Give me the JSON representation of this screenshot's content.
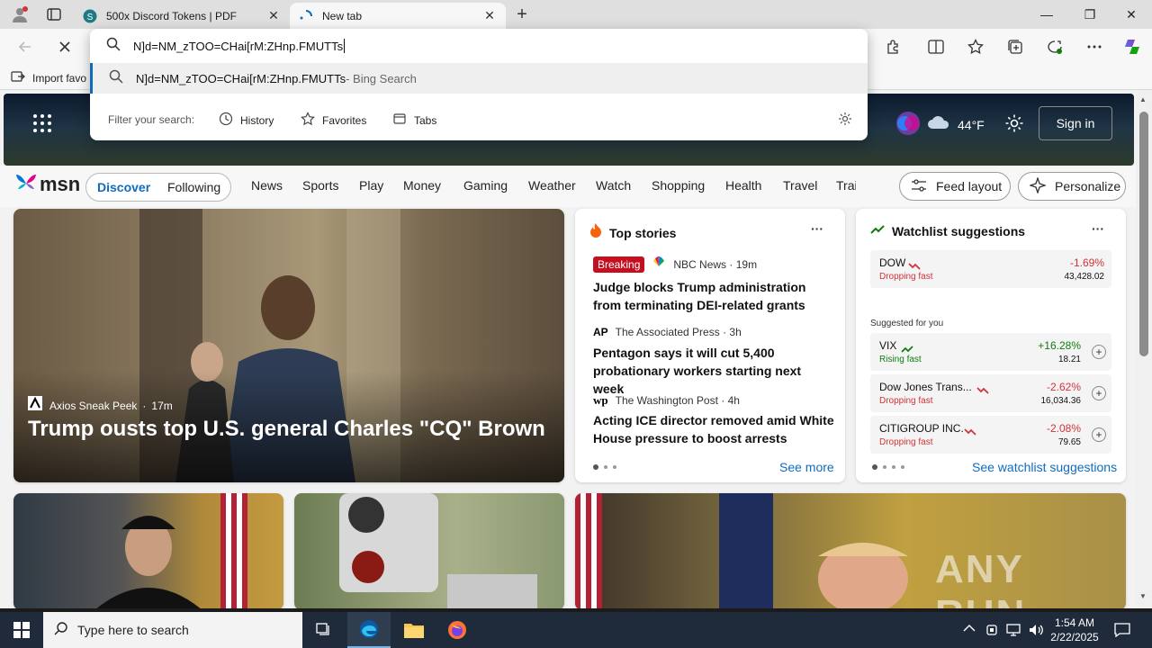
{
  "tabs": [
    {
      "title": "500x Discord Tokens | PDF",
      "close": "✕"
    },
    {
      "title": "New tab",
      "close": "✕"
    }
  ],
  "new_tab_symbol": "+",
  "window_controls": {
    "minimize": "—",
    "maximize": "❐",
    "close": "✕"
  },
  "omnibox": {
    "value": "N]d=NM_zTOO=CHai[rM:ZHnp.FMUTTs",
    "suggestion_text": "N]d=NM_zTOO=CHai[rM:ZHnp.FMUTTs",
    "suggestion_suffix": " - Bing Search",
    "filter_label": "Filter your search:",
    "filters": [
      "History",
      "Favorites",
      "Tabs"
    ]
  },
  "favorites_bar": {
    "import_label": "Import favo"
  },
  "msn": {
    "logo_text": "msn",
    "weather_temp": "44°F",
    "sign_in": "Sign in",
    "nav_tabs": [
      "Discover",
      "Following"
    ],
    "nav_links": [
      "News",
      "Sports",
      "Play",
      "Money",
      "Gaming",
      "Weather",
      "Watch",
      "Shopping",
      "Health",
      "Travel",
      "Trai"
    ],
    "feed_layout": "Feed layout",
    "personalize": "Personalize"
  },
  "hero": {
    "source": "Axios Sneak Peek",
    "age": "17m",
    "title": "Trump ousts top U.S. general Charles \"CQ\" Brown"
  },
  "top_stories": {
    "heading": "Top stories",
    "more": "···",
    "items": [
      {
        "badge": "Breaking",
        "source": "NBC News · 19m",
        "title": "Judge blocks Trump administration from terminating DEI-related grants"
      },
      {
        "source": "The Associated Press · 3h",
        "title": "Pentagon says it will cut 5,400 probationary workers starting next week"
      },
      {
        "source": "The Washington Post · 4h",
        "title": "Acting ICE director removed amid White House pressure to boost arrests"
      }
    ],
    "see_more": "See more"
  },
  "watchlist": {
    "heading": "Watchlist suggestions",
    "more": "···",
    "top": {
      "symbol": "DOW",
      "status": "Dropping fast",
      "change": "-1.69%",
      "price": "43,428.02"
    },
    "suggested_label": "Suggested for you",
    "items": [
      {
        "symbol": "VIX",
        "status": "Rising fast",
        "change": "+16.28%",
        "price": "18.21",
        "up": true
      },
      {
        "symbol": "Dow Jones Trans...",
        "status": "Dropping fast",
        "change": "-2.62%",
        "price": "16,034.36",
        "up": false
      },
      {
        "symbol": "CITIGROUP INC.",
        "status": "Dropping fast",
        "change": "-2.08%",
        "price": "79.65",
        "up": false
      }
    ],
    "see_all": "See watchlist suggestions"
  },
  "watermark": "ANY RUN",
  "taskbar": {
    "search_placeholder": "Type here to search",
    "time": "1:54 AM",
    "date": "2/22/2025"
  },
  "colors": {
    "accent": "#0f6cbd",
    "down": "#d13438",
    "up": "#107c10",
    "breaking": "#c50f1f"
  }
}
